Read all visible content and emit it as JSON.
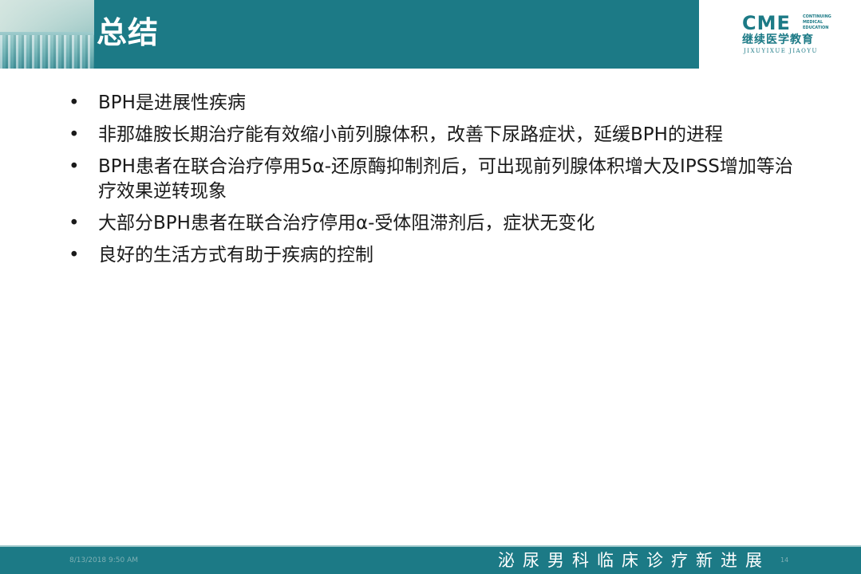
{
  "header": {
    "title": "总结",
    "logo": {
      "main": "CME",
      "side_lines": [
        "CONTINUING",
        "MEDICAL",
        "EDUCATION"
      ],
      "chinese": "继续医学教育",
      "pinyin": "JIXUYIXUE JIAOYU"
    }
  },
  "bullets": [
    "BPH是进展性疾病",
    "非那雄胺长期治疗能有效缩小前列腺体积，改善下尿路症状，延缓BPH的进程",
    "BPH患者在联合治疗停用5α-还原酶抑制剂后，可出现前列腺体积增大及IPSS增加等治疗效果逆转现象",
    "大部分BPH患者在联合治疗停用α-受体阻滞剂后，症状无变化",
    "良好的生活方式有助于疾病的控制"
  ],
  "bullet_symbol": "•",
  "footer": {
    "date": "8/13/2018 9:50 AM",
    "page": "14",
    "slogan": "泌尿男科临床诊疗新进展"
  },
  "colors": {
    "header": "#1c7a86",
    "text": "#1a1a1a",
    "footer": "#1c7a86"
  }
}
